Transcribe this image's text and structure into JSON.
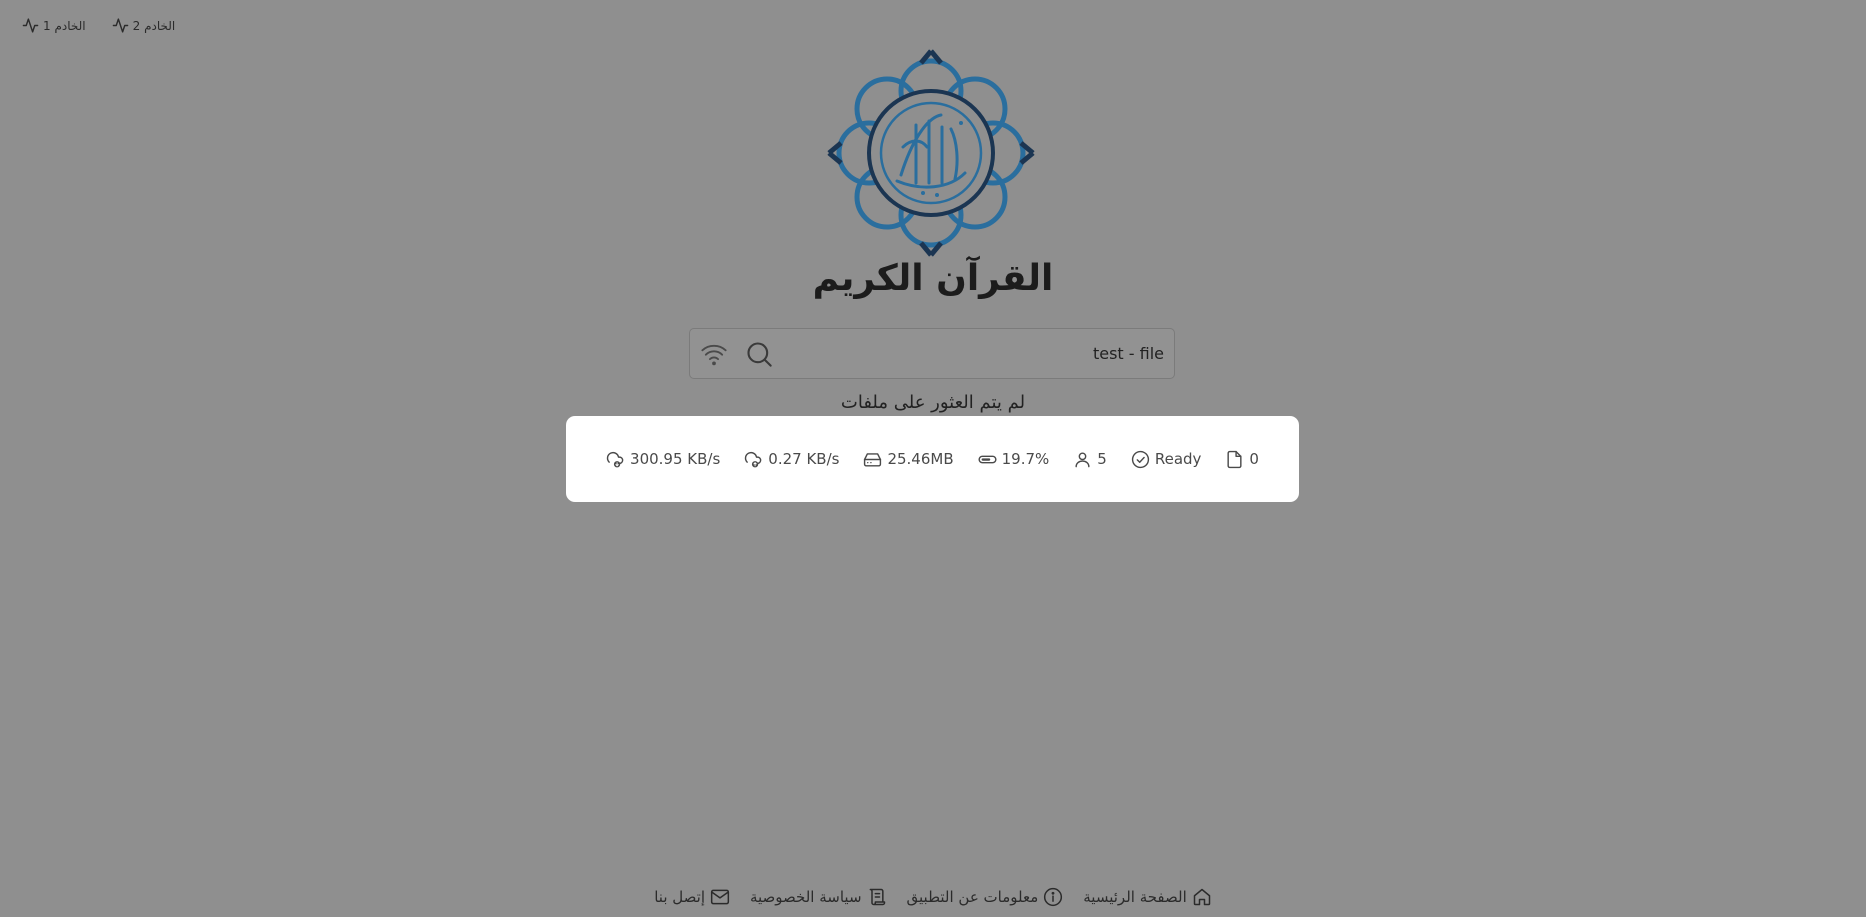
{
  "servers": [
    {
      "label": "الخادم 1",
      "icon": "activity-icon"
    },
    {
      "label": "الخادم 2",
      "icon": "activity-icon"
    }
  ],
  "logo": {
    "icon": "quran-calligraphy-logo",
    "colors": {
      "petal": "#2a6e9e",
      "outline": "#1b3552"
    }
  },
  "title": "القرآن الكريم",
  "search": {
    "value": "test - file",
    "icons": [
      "search-icon",
      "wifi-icon"
    ]
  },
  "status_message": "لم يتم العثور على ملفات",
  "stats": {
    "files": "0",
    "status": "Ready",
    "peers": "5",
    "progress": "19.7%",
    "storage": "25.46MB",
    "upload_speed": "0.27 KB/s",
    "download_speed": "300.95 KB/s"
  },
  "footer": {
    "home": "الصفحة الرئيسية",
    "about": "معلومات عن التطبيق",
    "privacy": "سياسة الخصوصية",
    "contact": "إتصل بنا"
  }
}
